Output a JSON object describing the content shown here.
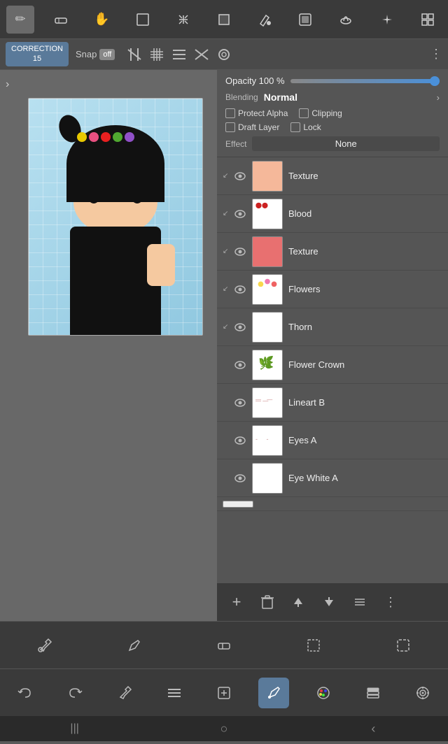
{
  "topToolbar": {
    "tools": [
      "✏️",
      "◻",
      "✋",
      "⬜",
      "✛",
      "■",
      "🪣",
      "▭",
      "⬬",
      "✦",
      "⊞"
    ]
  },
  "secToolbar": {
    "correction_label": "CORRECTION",
    "correction_value": "15",
    "snap_label": "Snap",
    "snap_state": "off",
    "more_icon": "⋮"
  },
  "properties": {
    "opacity_label": "Opacity 100 %",
    "blending_label": "Blending",
    "blending_value": "Normal",
    "protect_alpha_label": "Protect Alpha",
    "clipping_label": "Clipping",
    "draft_layer_label": "Draft Layer",
    "lock_label": "Lock",
    "effect_label": "Effect",
    "effect_value": "None"
  },
  "layers": [
    {
      "id": 1,
      "name": "Texture",
      "thumbType": "peach",
      "hasEye": true,
      "hasMerge": true,
      "indent": true
    },
    {
      "id": 2,
      "name": "Blood",
      "thumbType": "blood",
      "hasEye": true,
      "hasMerge": true,
      "indent": true
    },
    {
      "id": 3,
      "name": "Texture",
      "thumbType": "pink",
      "hasEye": true,
      "hasMerge": true,
      "indent": true
    },
    {
      "id": 4,
      "name": "Flowers",
      "thumbType": "flowers",
      "hasEye": true,
      "hasMerge": true,
      "indent": true
    },
    {
      "id": 5,
      "name": "Thorn",
      "thumbType": "white",
      "hasEye": true,
      "hasMerge": true,
      "indent": true
    },
    {
      "id": 6,
      "name": "Flower Crown",
      "thumbType": "flower-crown",
      "hasEye": true,
      "hasMerge": false,
      "indent": false
    },
    {
      "id": 7,
      "name": "Lineart B",
      "thumbType": "lineart",
      "hasEye": true,
      "hasMerge": false,
      "indent": false
    },
    {
      "id": 8,
      "name": "Eyes A",
      "thumbType": "eyes",
      "hasEye": true,
      "hasMerge": false,
      "indent": false
    },
    {
      "id": 9,
      "name": "Eye White A",
      "thumbType": "white",
      "hasEye": true,
      "hasMerge": false,
      "indent": false
    }
  ],
  "layerActions": {
    "add": "+",
    "delete": "🗑",
    "up": "↑",
    "down": "↓",
    "list": "☰",
    "more": "⋮"
  },
  "bottomTools1": {
    "tools": [
      "eyedropper",
      "pencil",
      "eraser",
      "selection",
      "lasso"
    ]
  },
  "bottomTools2": {
    "tools": [
      "undo",
      "redo",
      "eyedropper2",
      "menu",
      "edit",
      "transform",
      "color",
      "layer-stack",
      "target"
    ]
  },
  "navBar": {
    "items": [
      "|||",
      "○",
      "‹"
    ]
  }
}
